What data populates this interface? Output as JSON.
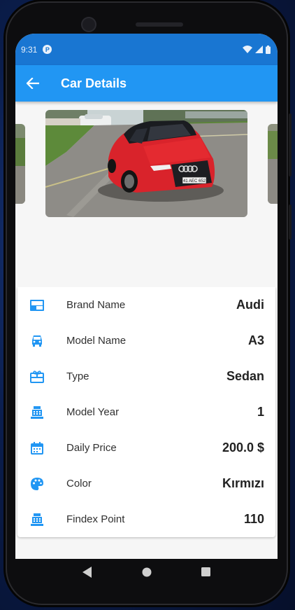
{
  "status_bar": {
    "time": "9:31",
    "notification_letter": "P"
  },
  "app_bar": {
    "title": "Car Details"
  },
  "colors": {
    "primary": "#2196f3",
    "status_bar": "#1976d2",
    "icon": "#2196f3",
    "car_red": "#d9232b"
  },
  "details": [
    {
      "icon": "brand-icon",
      "label": "Brand Name",
      "value": "Audi"
    },
    {
      "icon": "car-icon",
      "label": "Model Name",
      "value": "A3"
    },
    {
      "icon": "gift-card-icon",
      "label": "Type",
      "value": "Sedan"
    },
    {
      "icon": "cash-register-icon",
      "label": "Model Year",
      "value": "1"
    },
    {
      "icon": "calendar-icon",
      "label": "Daily Price",
      "value": "200.0 $"
    },
    {
      "icon": "palette-icon",
      "label": "Color",
      "value": "Kırmızı"
    },
    {
      "icon": "cash-register-icon",
      "label": "Findex Point",
      "value": "110"
    }
  ],
  "car_plate": "41 AEC 652"
}
